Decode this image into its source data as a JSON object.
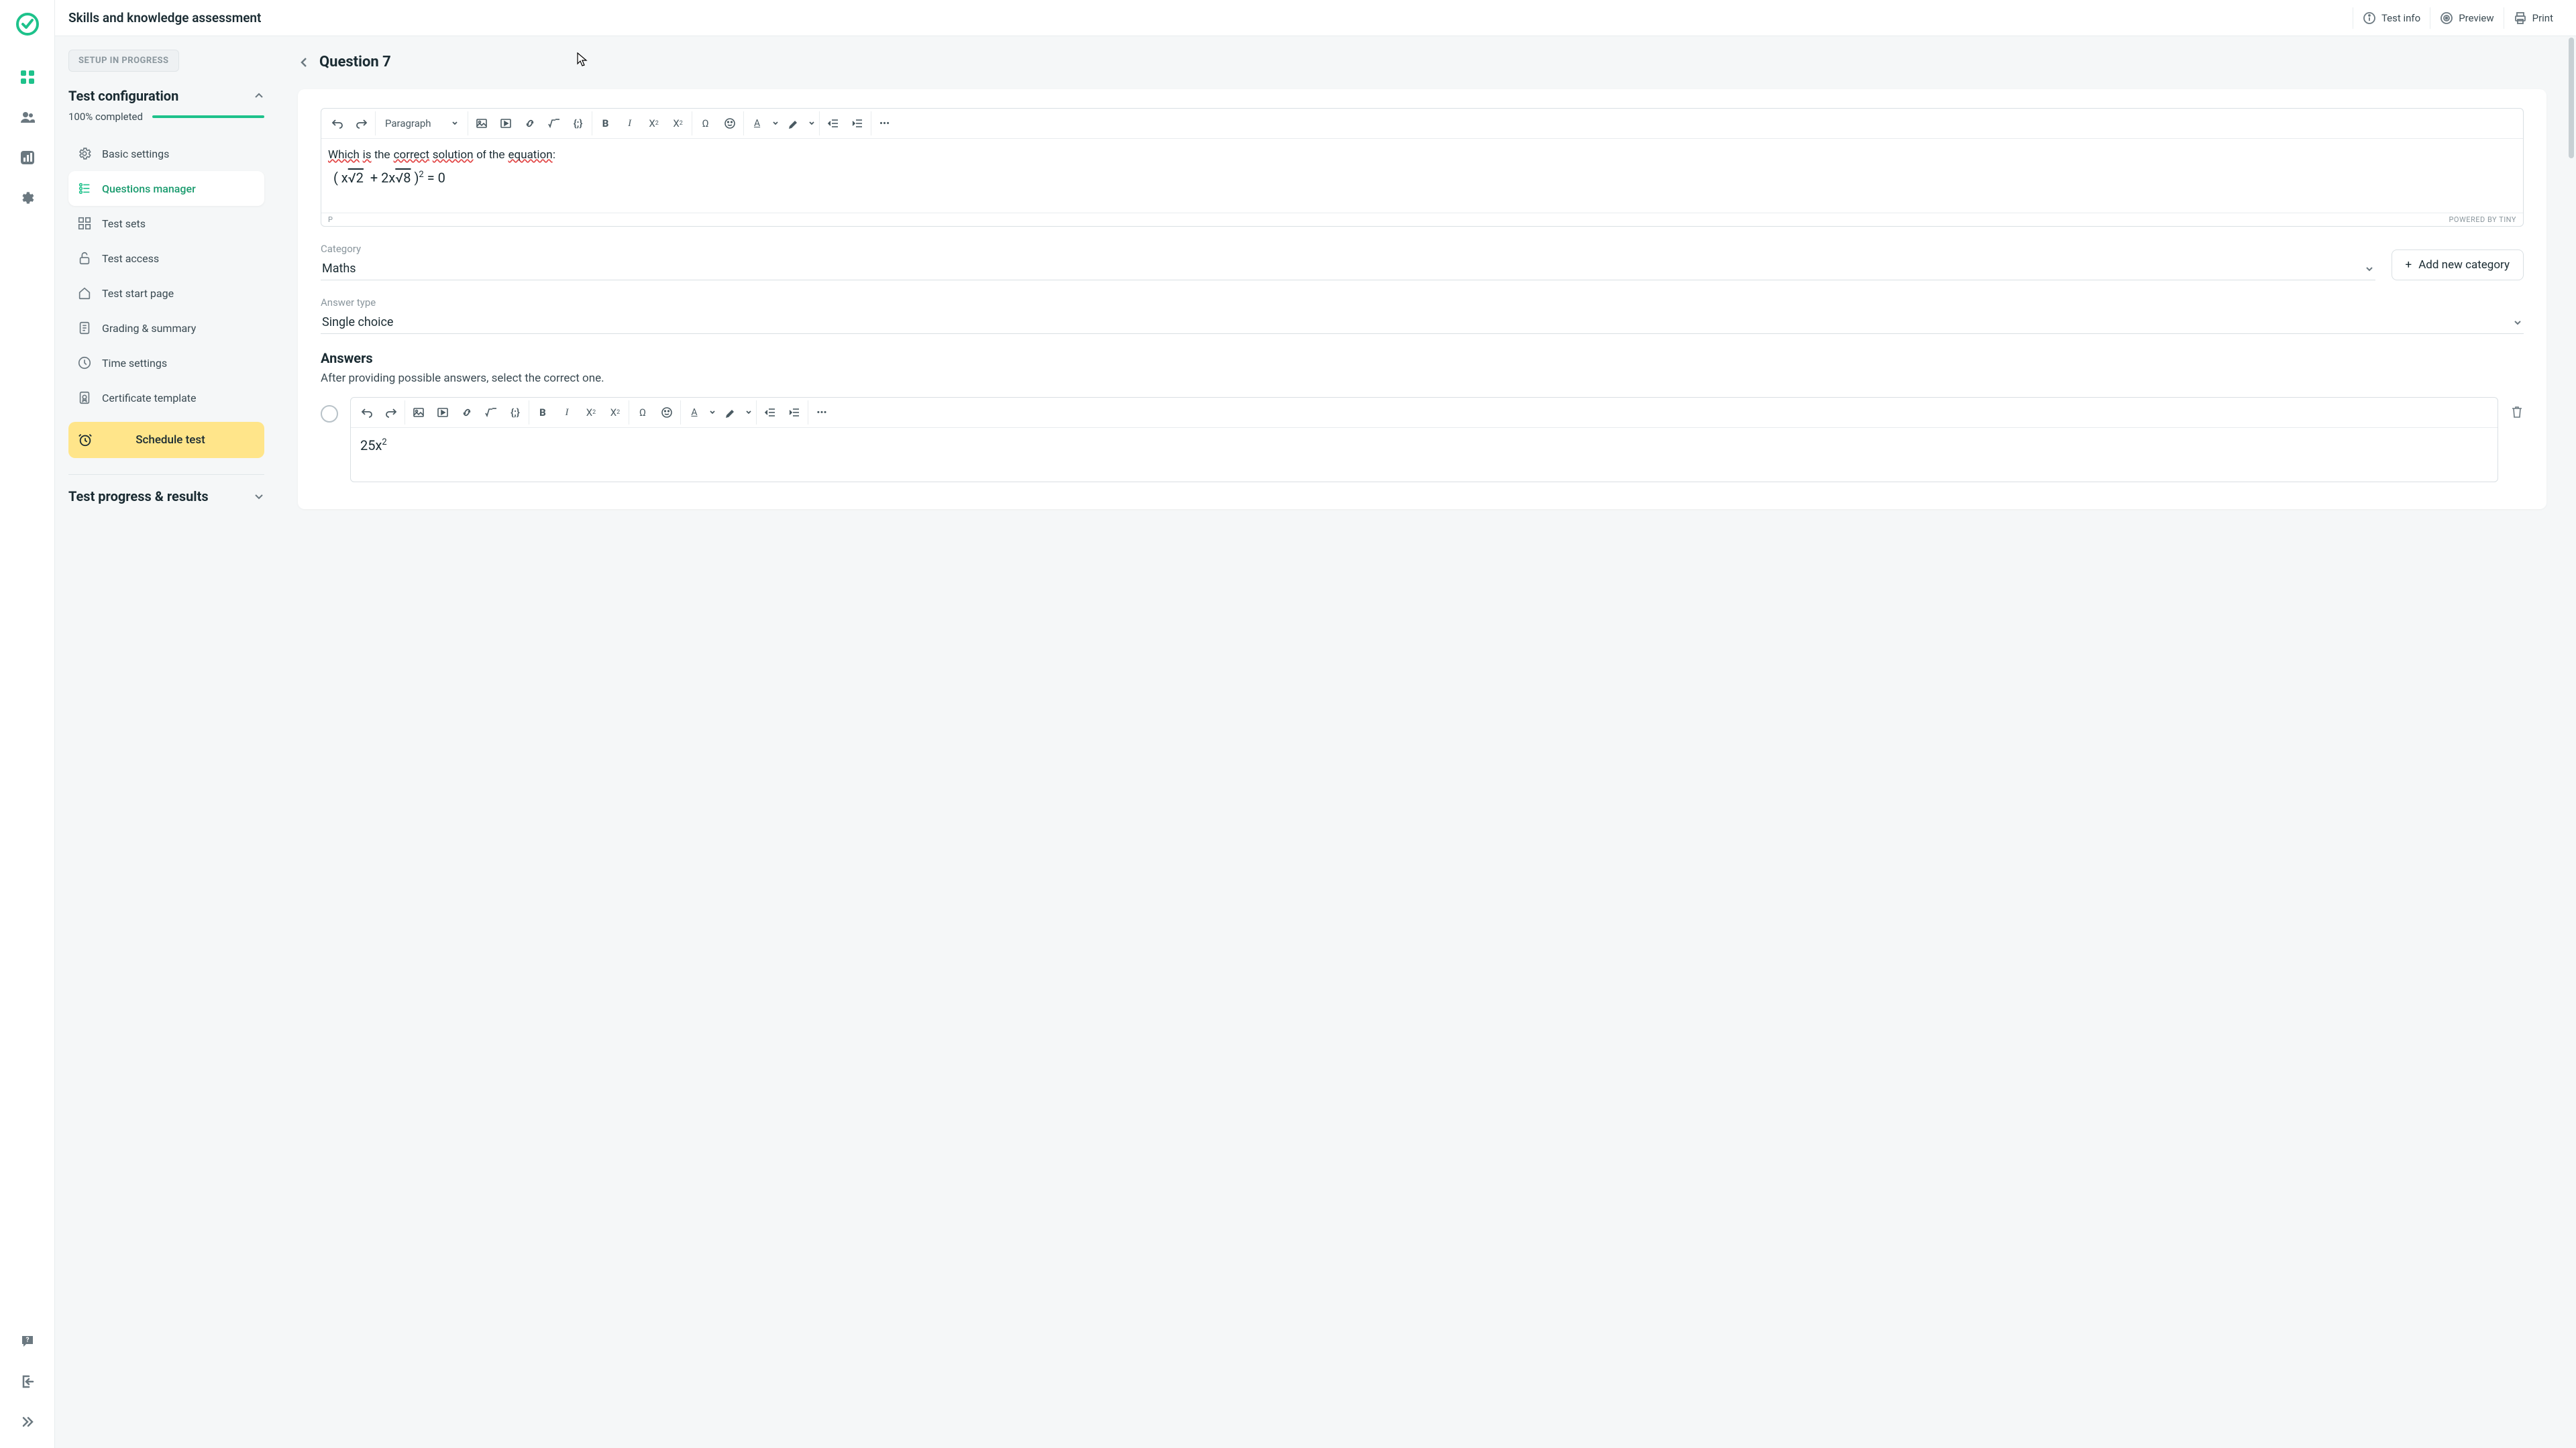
{
  "header": {
    "title": "Skills and knowledge assessment",
    "actions": {
      "test_info": "Test info",
      "preview": "Preview",
      "print": "Print"
    }
  },
  "sidebar": {
    "setup_badge": "SETUP IN PROGRESS",
    "config_title": "Test configuration",
    "progress_text": "100% completed",
    "progress_pct": 100,
    "items": [
      {
        "label": "Basic settings"
      },
      {
        "label": "Questions manager"
      },
      {
        "label": "Test sets"
      },
      {
        "label": "Test access"
      },
      {
        "label": "Test start page"
      },
      {
        "label": "Grading & summary"
      },
      {
        "label": "Time settings"
      },
      {
        "label": "Certificate template"
      }
    ],
    "schedule_label": "Schedule test",
    "results_title": "Test progress & results"
  },
  "question": {
    "title": "Question 7",
    "footer_path": "P",
    "footer_powered": "POWERED BY TINY",
    "toolbar_paragraph": "Paragraph",
    "category_label": "Category",
    "category_value": "Maths",
    "add_category": "Add new category",
    "answer_type_label": "Answer type",
    "answer_type_value": "Single choice",
    "answers_title": "Answers",
    "answers_hint": "After providing possible answers, select the correct one.",
    "body": {
      "prompt_words": [
        "Which",
        "is",
        "the",
        "correct",
        "solution",
        "of",
        "the",
        "equation"
      ],
      "equation_display": "( x√2  + 2x√8 )² = 0"
    },
    "answer_1": "25x²"
  }
}
